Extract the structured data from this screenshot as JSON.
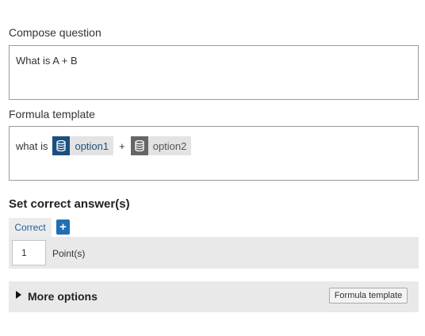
{
  "compose": {
    "label": "Compose question",
    "value": "What is A + B"
  },
  "formula": {
    "label": "Formula template",
    "prefix": "what is",
    "operator": "+",
    "option1": "option1",
    "option2": "option2"
  },
  "answers": {
    "title": "Set correct answer(s)",
    "tab_label": "Correct",
    "add_label": "+",
    "points_value": "1",
    "points_label": "Point(s)"
  },
  "more": {
    "label": "More options",
    "button_label": "Formula template"
  },
  "colors": {
    "accent": "#1f6fb5",
    "chip1_icon_bg": "#1b4f7f",
    "chip2_icon_bg": "#666666",
    "chip_text_bg": "#e3e3e3"
  }
}
